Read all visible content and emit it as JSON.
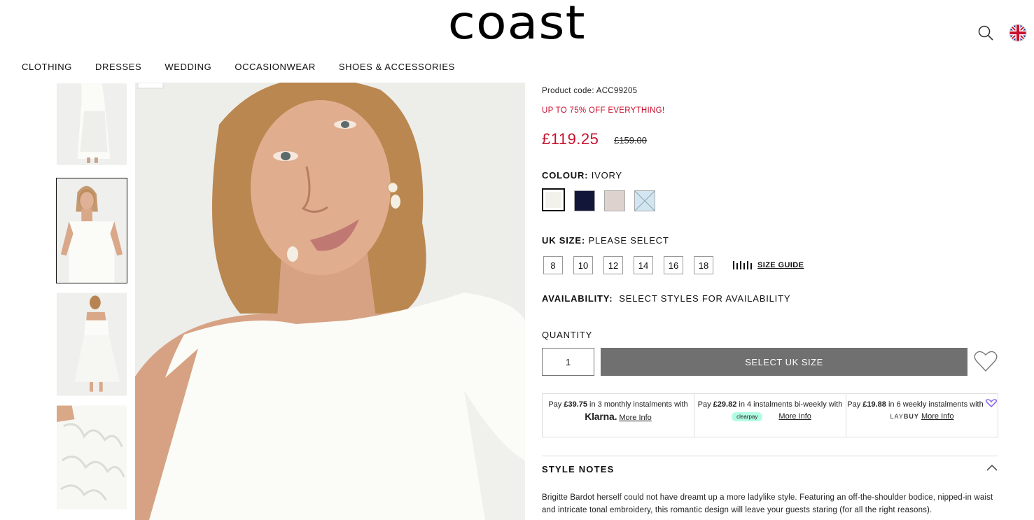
{
  "header": {
    "logo": "coast",
    "icons": [
      "search-icon",
      "uk-flag-icon"
    ]
  },
  "nav": [
    "CLOTHING",
    "DRESSES",
    "WEDDING",
    "OCCASIONWEAR",
    "SHOES & ACCESSORIES"
  ],
  "product": {
    "code_label": "Product code: ACC99205",
    "promo": "UP TO 75% OFF EVERYTHING!",
    "price": "£119.25",
    "was_price": "£159.00",
    "colour_label": "COLOUR:",
    "colour_value": "IVORY",
    "colours": [
      {
        "name": "ivory",
        "hex": "#f2f1ec"
      },
      {
        "name": "navy",
        "hex": "#12173a"
      },
      {
        "name": "blush",
        "hex": "#ddd2cd"
      },
      {
        "name": "pale blue",
        "hex": "#d3e5f1"
      }
    ],
    "size_label": "UK SIZE:",
    "size_value": "PLEASE SELECT",
    "sizes": [
      "8",
      "10",
      "12",
      "14",
      "16",
      "18"
    ],
    "size_guide": "SIZE GUIDE",
    "availability_label": "AVAILABILITY:",
    "availability_value": "SELECT STYLES FOR AVAILABILITY",
    "quantity_label": "QUANTITY",
    "quantity": "1",
    "cta": "SELECT UK SIZE"
  },
  "bnpl": {
    "klarna": {
      "pre": "Pay ",
      "amount": "£39.75",
      "mid": " in 3 monthly instalments with ",
      "brand": "Klarna.",
      "more": "More Info"
    },
    "clearpay": {
      "pre": "Pay ",
      "amount": "£29.82",
      "mid": " in 4 instalments bi-weekly with",
      "brand": "clearpay",
      "more": "More Info"
    },
    "laybuy": {
      "pre": "Pay ",
      "amount": "£19.88",
      "mid": " in 6 weekly instalments with",
      "brand_a": "LAY",
      "brand_b": "BUY",
      "more": "More Info"
    }
  },
  "style_notes": {
    "title": "STYLE NOTES",
    "text": "Brigitte Bardot herself could not have dreamt up a more ladylike style. Featuring an off-the-shoulder bodice, nipped-in waist and intricate tonal embroidery, this romantic design will leave your guests staring (for all the right reasons)."
  },
  "colors": {
    "sale": "#c8102e",
    "button": "#707070"
  }
}
